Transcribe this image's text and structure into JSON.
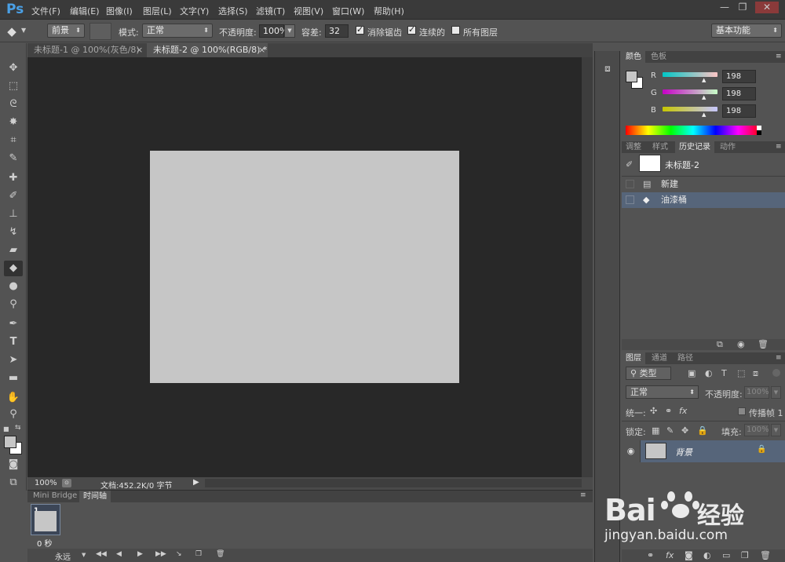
{
  "app": {
    "logo": "Ps",
    "menu": [
      "文件(F)",
      "编辑(E)",
      "图像(I)",
      "图层(L)",
      "文字(Y)",
      "选择(S)",
      "滤镜(T)",
      "视图(V)",
      "窗口(W)",
      "帮助(H)"
    ],
    "window_controls": [
      "—",
      "❐",
      "✕"
    ]
  },
  "options": {
    "fill_source": "前景",
    "mode_label": "模式:",
    "mode_value": "正常",
    "opacity_label": "不透明度:",
    "opacity_value": "100%",
    "tolerance_label": "容差:",
    "tolerance_value": "32",
    "antialias_label": "消除锯齿",
    "contiguous_label": "连续的",
    "all_layers_label": "所有图层",
    "workspace": "基本功能"
  },
  "tabs": [
    {
      "label": "未标题-1 @ 100%(灰色/8)",
      "active": false
    },
    {
      "label": "未标题-2 @ 100%(RGB/8) *",
      "active": true
    }
  ],
  "status": {
    "zoom": "100%",
    "doc_info": "文档:452.2K/0 字节"
  },
  "timeline": {
    "tabs": [
      "Mini Bridge",
      "时间轴"
    ],
    "frame_number": "1",
    "frame_delay": "0 秒",
    "loop": "永远"
  },
  "color_panel": {
    "tabs": [
      "颜色",
      "色板"
    ],
    "channels": [
      {
        "label": "R",
        "value": "198"
      },
      {
        "label": "G",
        "value": "198"
      },
      {
        "label": "B",
        "value": "198"
      }
    ],
    "foreground": "#c6c6c6"
  },
  "history_panel": {
    "tabs": [
      "调整",
      "样式",
      "历史记录",
      "动作"
    ],
    "snapshot": "未标题-2",
    "items": [
      {
        "label": "新建",
        "icon": "document-icon",
        "selected": false
      },
      {
        "label": "油漆桶",
        "icon": "paint-bucket-icon",
        "selected": true
      }
    ]
  },
  "layers_panel": {
    "tabs": [
      "图层",
      "通道",
      "路径"
    ],
    "filter": "类型",
    "blend_mode": "正常",
    "opacity_label": "不透明度:",
    "opacity_value": "100%",
    "unify_label": "统一:",
    "propagate_label": "传播帧 1",
    "lock_label": "锁定:",
    "fill_label": "填充:",
    "fill_value": "100%",
    "layer_name": "背景"
  },
  "watermark": {
    "brand": "Bai",
    "brand_cn": "经验",
    "url": "jingyan.baidu.com"
  }
}
